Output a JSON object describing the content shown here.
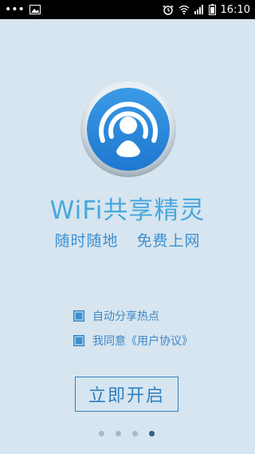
{
  "status_bar": {
    "time": "16:10",
    "icons": [
      "overflow-dots-icon",
      "image-notification-icon",
      "alarm-icon",
      "wifi-icon",
      "signal-icon",
      "battery-icon"
    ]
  },
  "app": {
    "title": "WiFi共享精灵",
    "slogan_part1": "随时随地",
    "slogan_part2": "免费上网"
  },
  "options": [
    {
      "label": "自动分享热点",
      "checked": true
    },
    {
      "label": "我同意《用户协议》",
      "checked": true
    }
  ],
  "start_button": {
    "label": "立即开启"
  },
  "pager": {
    "count": 4,
    "active_index": 3
  },
  "colors": {
    "background": "#d6e5ef",
    "accent": "#3e8fd0",
    "title": "#49a7dd",
    "statusbar": "#000000"
  }
}
